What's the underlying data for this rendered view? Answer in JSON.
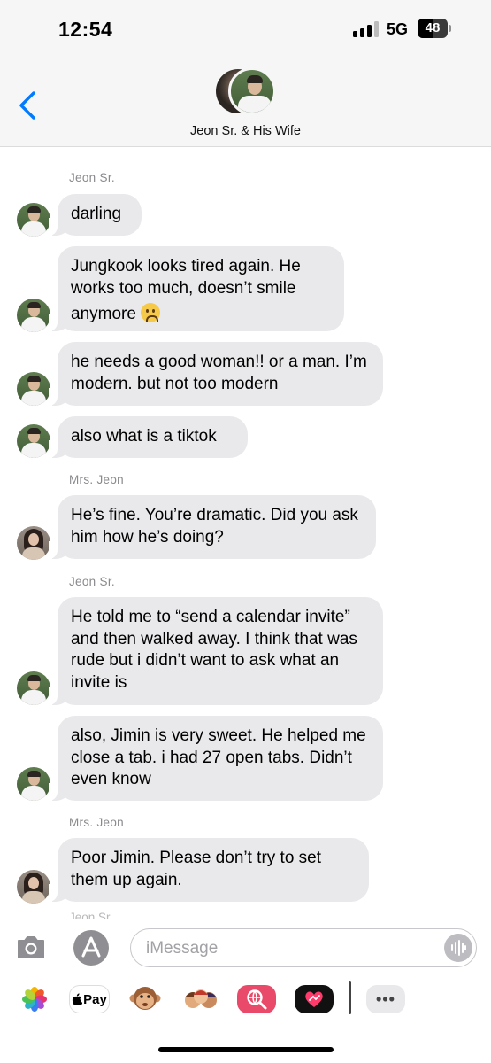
{
  "status_bar": {
    "time": "12:54",
    "network": "5G",
    "battery": "48"
  },
  "header": {
    "title": "Jeon Sr. & His Wife"
  },
  "messages": [
    {
      "sender": "Jeon Sr."
    },
    {
      "text": "darling"
    },
    {
      "text": "Jungkook looks tired again. He works too much, doesn’t smile anymore"
    },
    {
      "text": "he needs a good woman!! or a man. I’m modern. but not too modern"
    },
    {
      "text": "also what is a tiktok"
    },
    {
      "sender": "Mrs. Jeon"
    },
    {
      "text": "He’s fine. You’re dramatic. Did you ask him how he’s doing?"
    },
    {
      "sender": "Jeon Sr."
    },
    {
      "text": "He told me to “send a calendar invite” and then walked away. I think that was rude but i didn’t want to ask what an invite is"
    },
    {
      "text": "also, Jimin is very sweet. He helped me close a tab. i had 27 open tabs. Didn’t even know"
    },
    {
      "sender": "Mrs. Jeon"
    },
    {
      "text": "Poor Jimin. Please don’t try to set them up again."
    },
    {
      "sender": "Jeon Sr."
    }
  ],
  "input": {
    "placeholder": "iMessage"
  },
  "app_drawer": {
    "pay_label": "Pay",
    "more_label": "•••"
  },
  "icons": [
    "back-chevron-icon",
    "camera-icon",
    "app-store-icon",
    "audio-waveform-icon",
    "photos-icon",
    "apple-pay-icon",
    "monkey-emoji-icon",
    "memoji-icon",
    "web-search-icon",
    "digital-touch-icon",
    "more-icon"
  ],
  "colors": {
    "accent": "#007aff",
    "bubble": "#e9e9eb",
    "secondary_text": "#8a8a8e"
  }
}
